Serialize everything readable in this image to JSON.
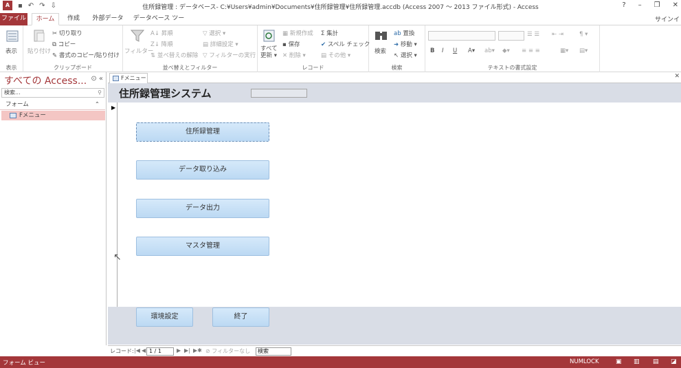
{
  "window": {
    "title": "住所録管理 : データベース- C:¥Users¥admin¥Documents¥住所録管理¥住所録管理.accdb (Access 2007 ～ 2013 ファイル形式) - Access",
    "signin": "サインイ",
    "help": "?",
    "minimize": "–",
    "restore": "❐",
    "close": "✕"
  },
  "tabs": {
    "file": "ファイル",
    "home": "ホーム",
    "create": "作成",
    "external": "外部データ",
    "dbtools": "データベース ツール"
  },
  "ribbon": {
    "view": {
      "button": "表示",
      "group": "表示"
    },
    "clipboard": {
      "paste": "貼り付け",
      "cut": "切り取り",
      "copy": "コピー",
      "format_painter": "書式のコピー/貼り付け",
      "group": "クリップボード"
    },
    "sortfilter": {
      "filter": "フィルター",
      "asc": "昇順",
      "desc": "降順",
      "clear_sort": "並べ替えの解除",
      "selection": "選択 ▾",
      "advanced": "詳細設定 ▾",
      "toggle": "フィルターの実行",
      "group": "並べ替えとフィルター"
    },
    "records": {
      "refresh": "すべて更新 ▾",
      "new": "新規作成",
      "save": "保存",
      "delete": "削除 ▾",
      "totals": "集計",
      "spelling": "スペル チェック",
      "more": "その他 ▾",
      "group": "レコード"
    },
    "find": {
      "find": "検索",
      "replace": "置換",
      "goto": "移動 ▾",
      "select": "選択 ▾",
      "group": "検索"
    },
    "text": {
      "bold": "B",
      "italic": "I",
      "underline": "U",
      "group": "テキストの書式設定"
    }
  },
  "nav": {
    "title": "すべての Access...",
    "search_placeholder": "検索...",
    "group": "フォーム",
    "item": "Fメニュー"
  },
  "doc": {
    "tab": "Fメニュー"
  },
  "form": {
    "title": "住所録管理システム",
    "buttons": [
      "住所録管理",
      "データ取り込み",
      "データ出力",
      "マスタ管理"
    ],
    "settings": "環境設定",
    "exit": "終了"
  },
  "recnav": {
    "label": "レコード:",
    "current": "1 / 1",
    "filter": "フィルターなし",
    "search": "検索"
  },
  "status": {
    "view": "フォーム ビュー",
    "numlock": "NUMLOCK"
  },
  "colors": {
    "accent": "#a4373a",
    "form_band": "#d9dde6",
    "button": "#bcd9f3"
  }
}
